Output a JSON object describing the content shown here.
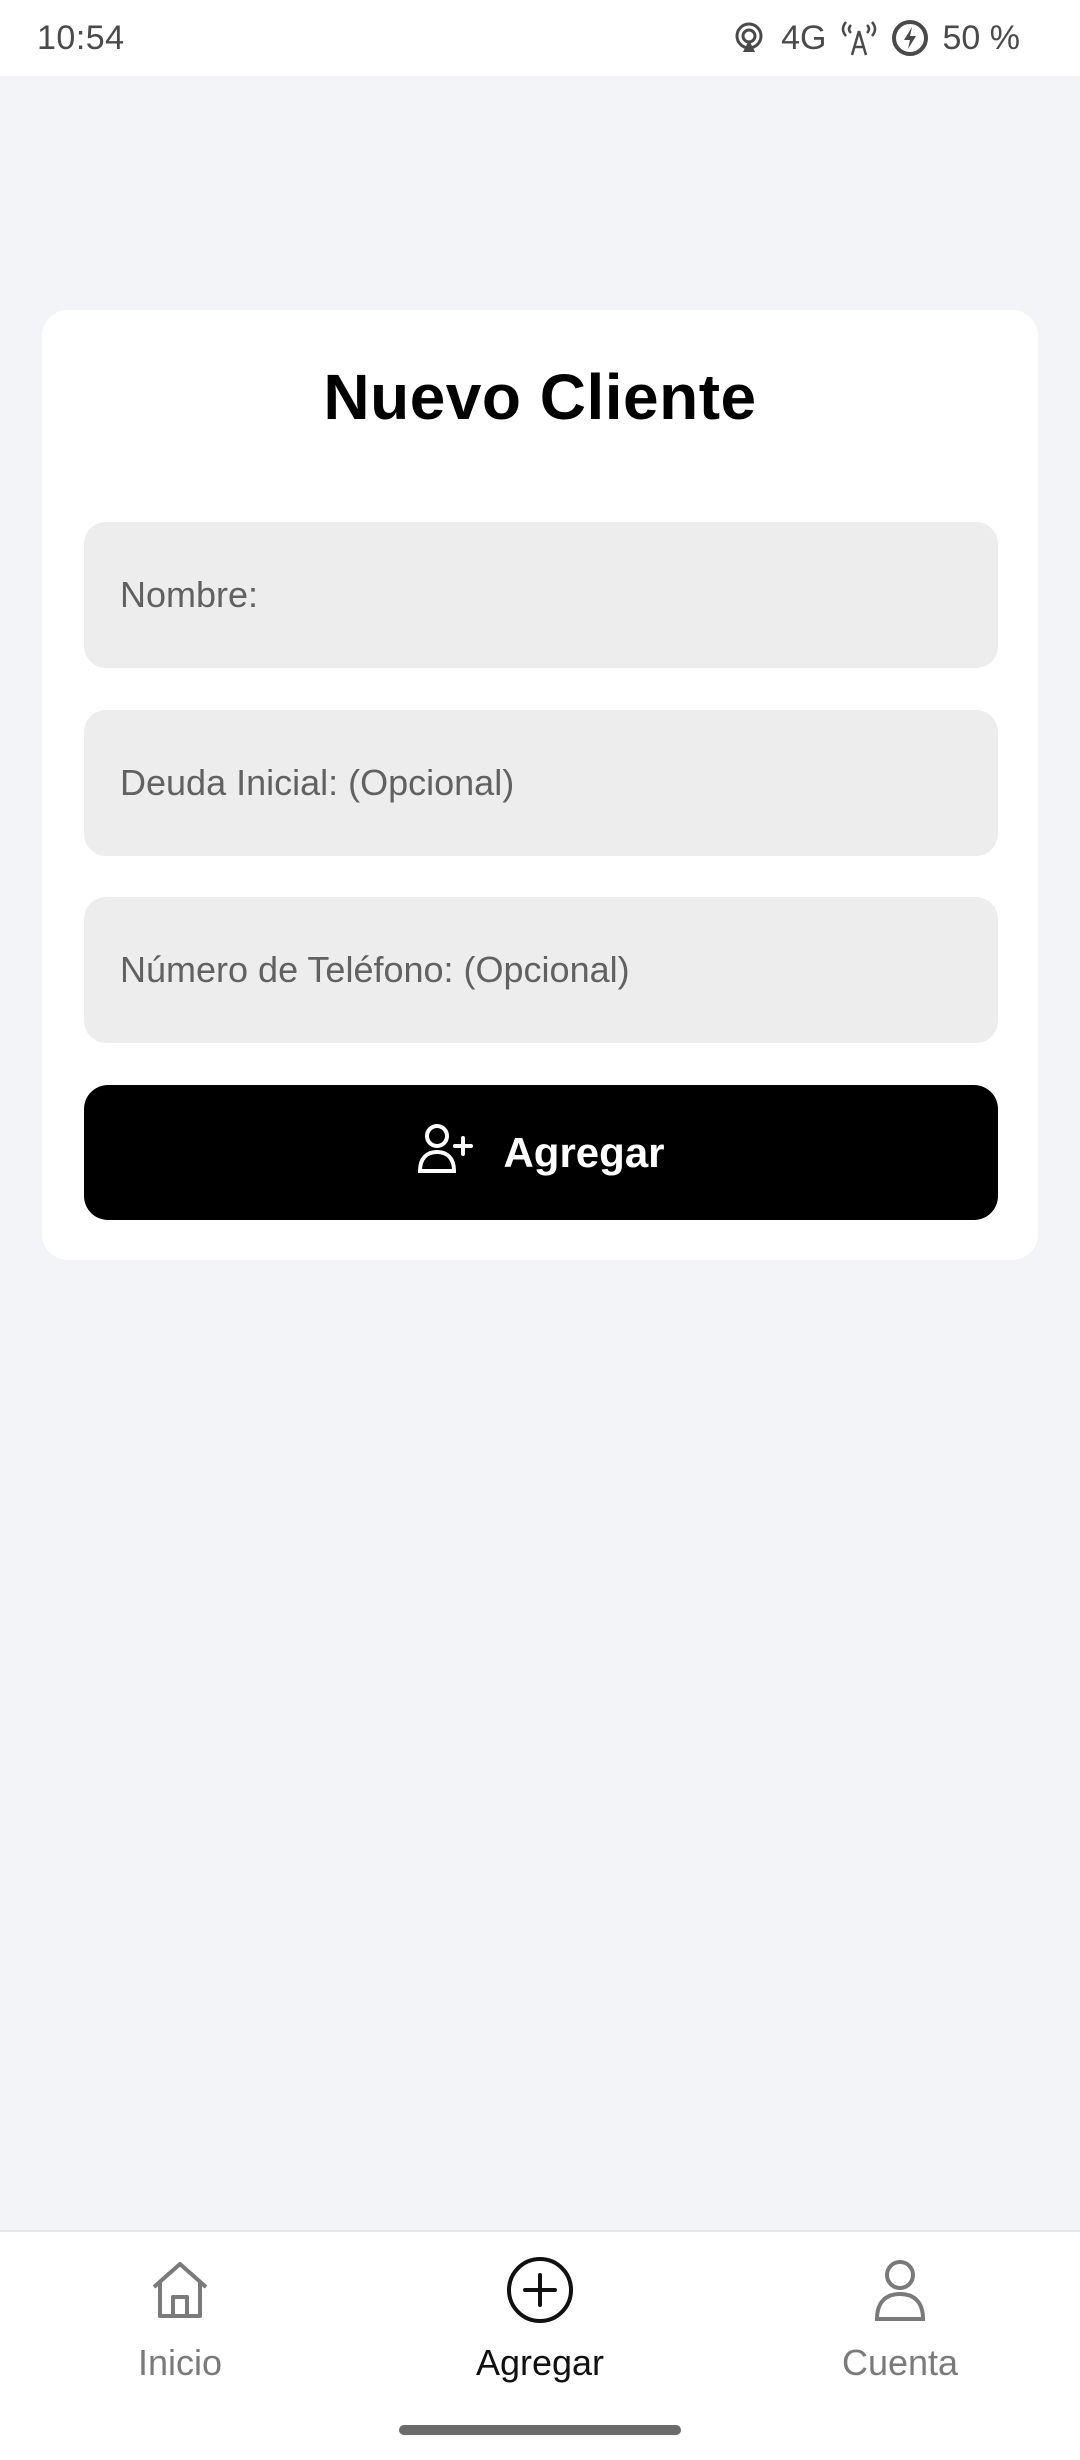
{
  "status_bar": {
    "time": "10:54",
    "network": "4G",
    "battery": "50 %"
  },
  "form": {
    "title": "Nuevo Cliente",
    "fields": [
      {
        "placeholder": "Nombre:",
        "value": ""
      },
      {
        "placeholder": "Deuda Inicial: (Opcional)",
        "value": ""
      },
      {
        "placeholder": "Número de Teléfono: (Opcional)",
        "value": ""
      }
    ],
    "submit_label": "Agregar",
    "submit_icon": "user-plus-icon"
  },
  "bottom_nav": {
    "items": [
      {
        "label": "Inicio",
        "icon": "home-icon",
        "active": false
      },
      {
        "label": "Agregar",
        "icon": "plus-circle-icon",
        "active": true
      },
      {
        "label": "Cuenta",
        "icon": "user-icon",
        "active": false
      }
    ]
  },
  "colors": {
    "background": "#f3f4f8",
    "card": "#ffffff",
    "field": "#ededed",
    "button": "#000000",
    "nav_inactive": "#7a7a7a"
  }
}
